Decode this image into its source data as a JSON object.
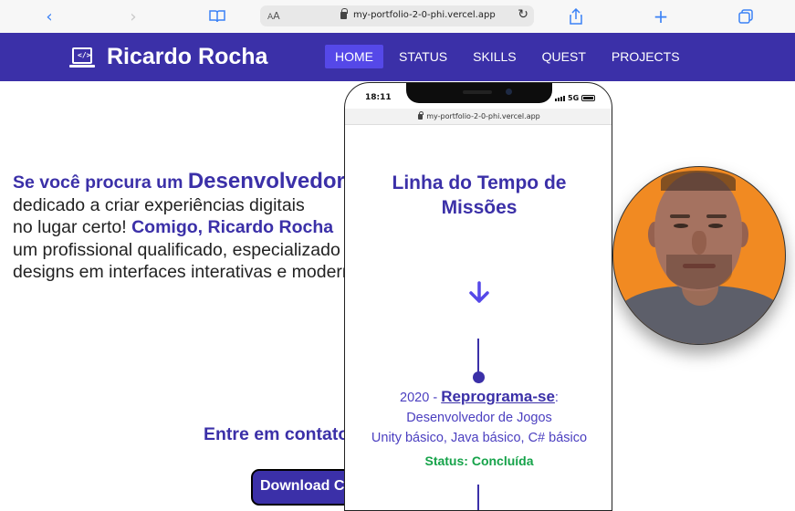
{
  "browser": {
    "aa_label_small": "A",
    "aa_label_big": "A",
    "url": "my-portfolio-2-0-phi.vercel.app"
  },
  "header": {
    "logo_icon": "laptop-code-icon",
    "title": "Ricardo Rocha",
    "nav": [
      {
        "label": "HOME",
        "active": true
      },
      {
        "label": "STATUS",
        "active": false
      },
      {
        "label": "SKILLS",
        "active": false
      },
      {
        "label": "QUEST",
        "active": false
      },
      {
        "label": "PROJECTS",
        "active": false
      }
    ]
  },
  "hero": {
    "line1_pre": "Se você procura um ",
    "line1_big": "Desenvolvedor",
    "line2": "dedicado a criar experiências digitais",
    "line3_pre": "no lugar certo! ",
    "line3_hl": "Comigo, Ricardo Rocha",
    "line4": "um profissional qualificado, especializado",
    "line5": "designs em interfaces interativas e modernas"
  },
  "contact": {
    "label": "Entre em contato"
  },
  "download": {
    "label": "Download CV"
  },
  "phone": {
    "time": "18:11",
    "network": "5G",
    "url": "my-portfolio-2-0-phi.vercel.app",
    "timeline_title_line1": "Linha do Tempo de",
    "timeline_title_line2": "Missões",
    "entry": {
      "year": "2020",
      "separator": " - ",
      "org": "Reprograma-se",
      "colon": ":",
      "role": "Desenvolvedor de Jogos",
      "skills": "Unity básico, Java básico, C# básico",
      "status_label": "Status:",
      "status_value": "Concluída"
    }
  },
  "colors": {
    "brand": "#3b30a8",
    "nav_active": "#5548e8",
    "status_green": "#16a34a",
    "avatar_bg": "#f18a22"
  }
}
